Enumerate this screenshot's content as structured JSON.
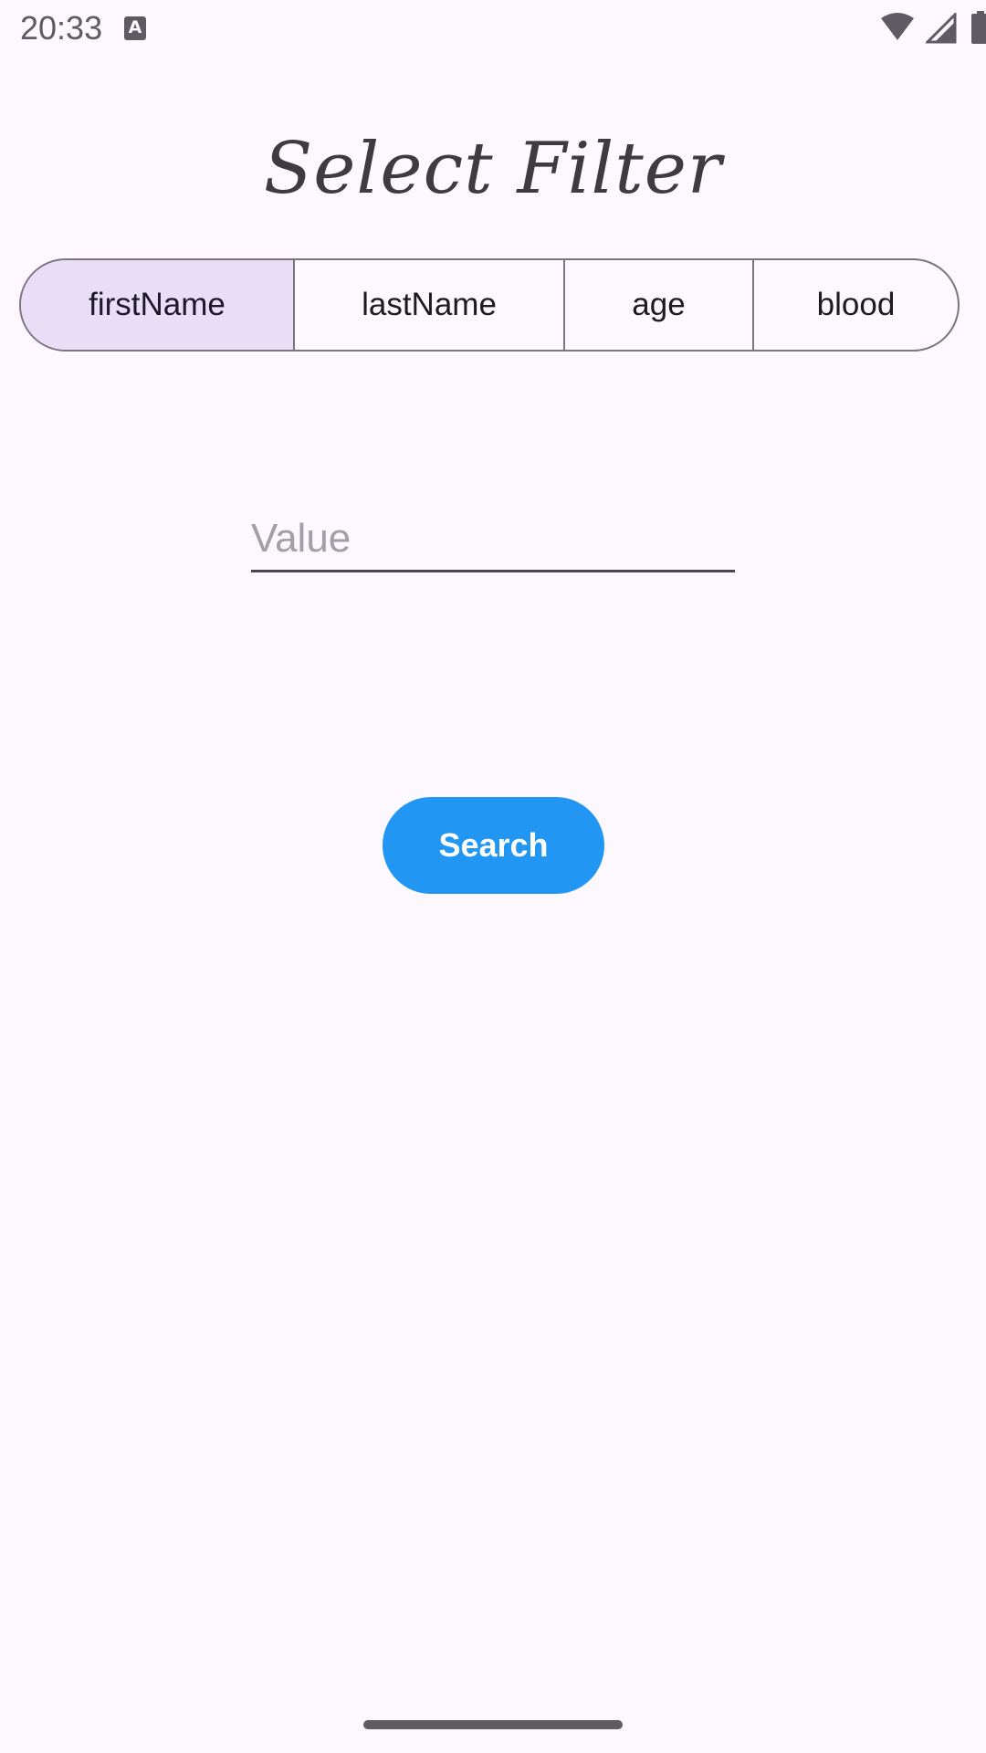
{
  "status_bar": {
    "time": "20:33",
    "notification_icon": "A"
  },
  "title": "Select Filter",
  "filter_segments": [
    {
      "label": "firstName",
      "selected": true
    },
    {
      "label": "lastName",
      "selected": false
    },
    {
      "label": "age",
      "selected": false
    },
    {
      "label": "blood",
      "selected": false
    }
  ],
  "value_input": {
    "placeholder": "Value",
    "value": ""
  },
  "search_button": {
    "label": "Search"
  },
  "colors": {
    "background": "#fdf7fe",
    "selected_segment": "#e8def8",
    "search_button": "#2196f3",
    "outline": "#79747e"
  }
}
